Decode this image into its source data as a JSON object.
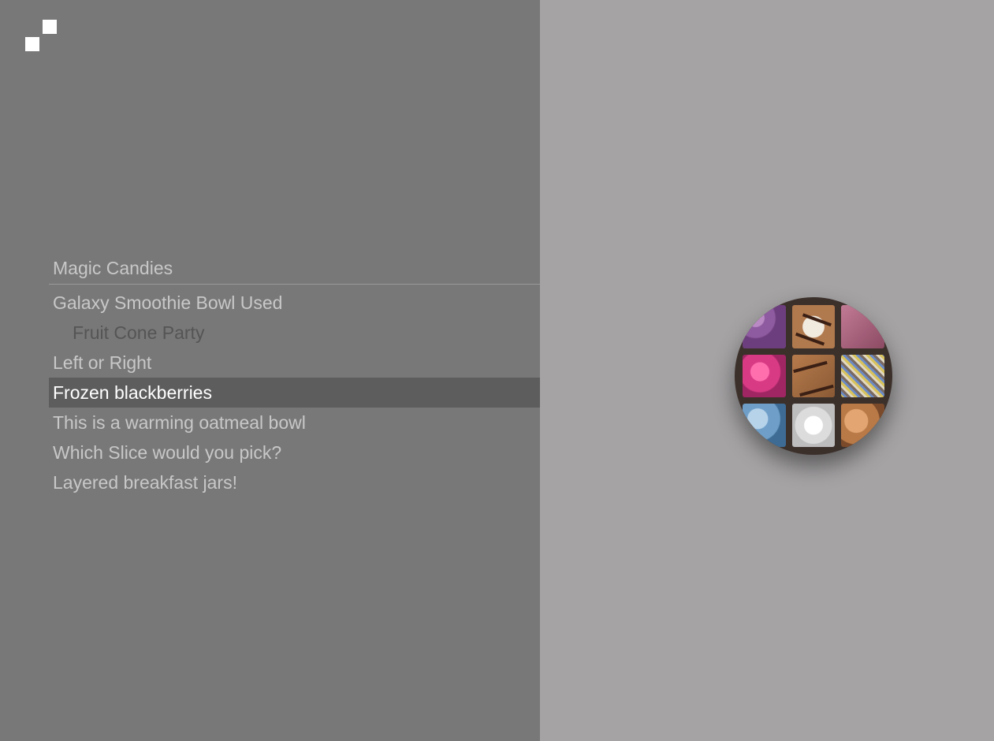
{
  "menu": {
    "header": "Magic Candies",
    "items": [
      {
        "label": "Galaxy Smoothie Bowl Used"
      },
      {
        "label": "Fruit Cone Party"
      },
      {
        "label": "Left or Right"
      },
      {
        "label": "Frozen blackberries"
      },
      {
        "label": "This is a warming oatmeal bowl"
      },
      {
        "label": "Which Slice would you pick?"
      },
      {
        "label": "Layered breakfast jars!"
      }
    ]
  },
  "colors": {
    "left_pane_bg": "#787878",
    "right_pane_bg": "#a5a3a4",
    "active_item_bg": "#5d5d5d",
    "sub_item_text": "#555555",
    "item_text": "#c8c8c8",
    "active_item_text": "#ffffff"
  },
  "icons": {
    "logo": "two-squares-logo-icon"
  }
}
